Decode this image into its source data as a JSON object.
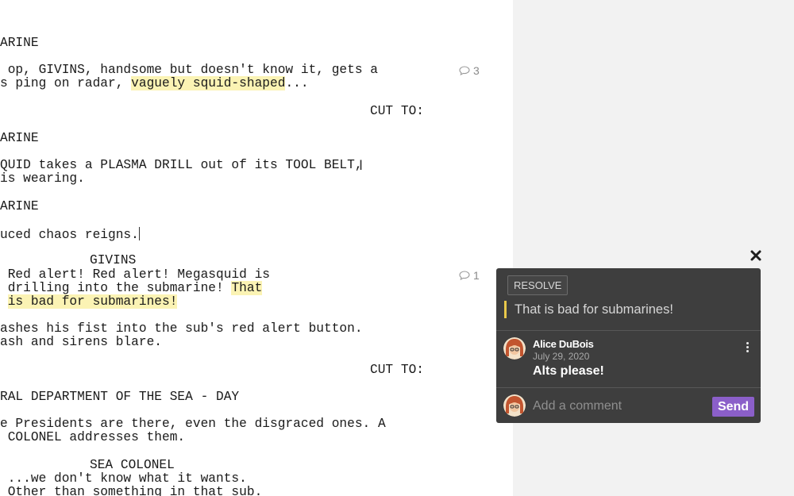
{
  "script": {
    "lines": [
      {
        "text": "ARINE"
      },
      {
        "text": " op, GIVINS, handsome but doesn't know it, gets a"
      },
      {
        "pre": "s ping on radar, ",
        "hl": "vaguely squid-shaped",
        "post": "..."
      },
      {
        "text": "CUT TO:"
      },
      {
        "text": "ARINE"
      },
      {
        "text": "QUID takes a PLASMA DRILL out of its TOOL BELT,"
      },
      {
        "text": "is wearing."
      },
      {
        "text": "ARINE"
      },
      {
        "text": "uced chaos reigns."
      },
      {
        "text": "GIVINS"
      },
      {
        "text": " Red alert! Red alert! Megasquid is"
      },
      {
        "pre": " drilling into the submarine! ",
        "hl": "That",
        "post": ""
      },
      {
        "pre": " ",
        "hl": "is bad for submarines!",
        "post": ""
      },
      {
        "text": "ashes his fist into the sub's red alert button."
      },
      {
        "text": "ash and sirens blare."
      },
      {
        "text": "CUT TO:"
      },
      {
        "text": "RAL DEPARTMENT OF THE SEA - DAY"
      },
      {
        "text": "e Presidents are there, even the disgraced ones. A"
      },
      {
        "text": " COLONEL addresses them."
      },
      {
        "text": "SEA COLONEL"
      },
      {
        "text": " ...we don't know what it wants."
      },
      {
        "text": " Other than something in that sub."
      }
    ],
    "comment_counts": [
      "3",
      "1"
    ]
  },
  "comment_panel": {
    "resolve_label": "RESOLVE",
    "quote": "That is bad for submarines!",
    "comment": {
      "author": "Alice DuBois",
      "date": "July 29, 2020",
      "text": "Alts please!"
    },
    "input_placeholder": "Add a comment",
    "send_label": "Send",
    "accent_color": "#8b5fc9",
    "highlight_color": "#fbf3b4"
  }
}
